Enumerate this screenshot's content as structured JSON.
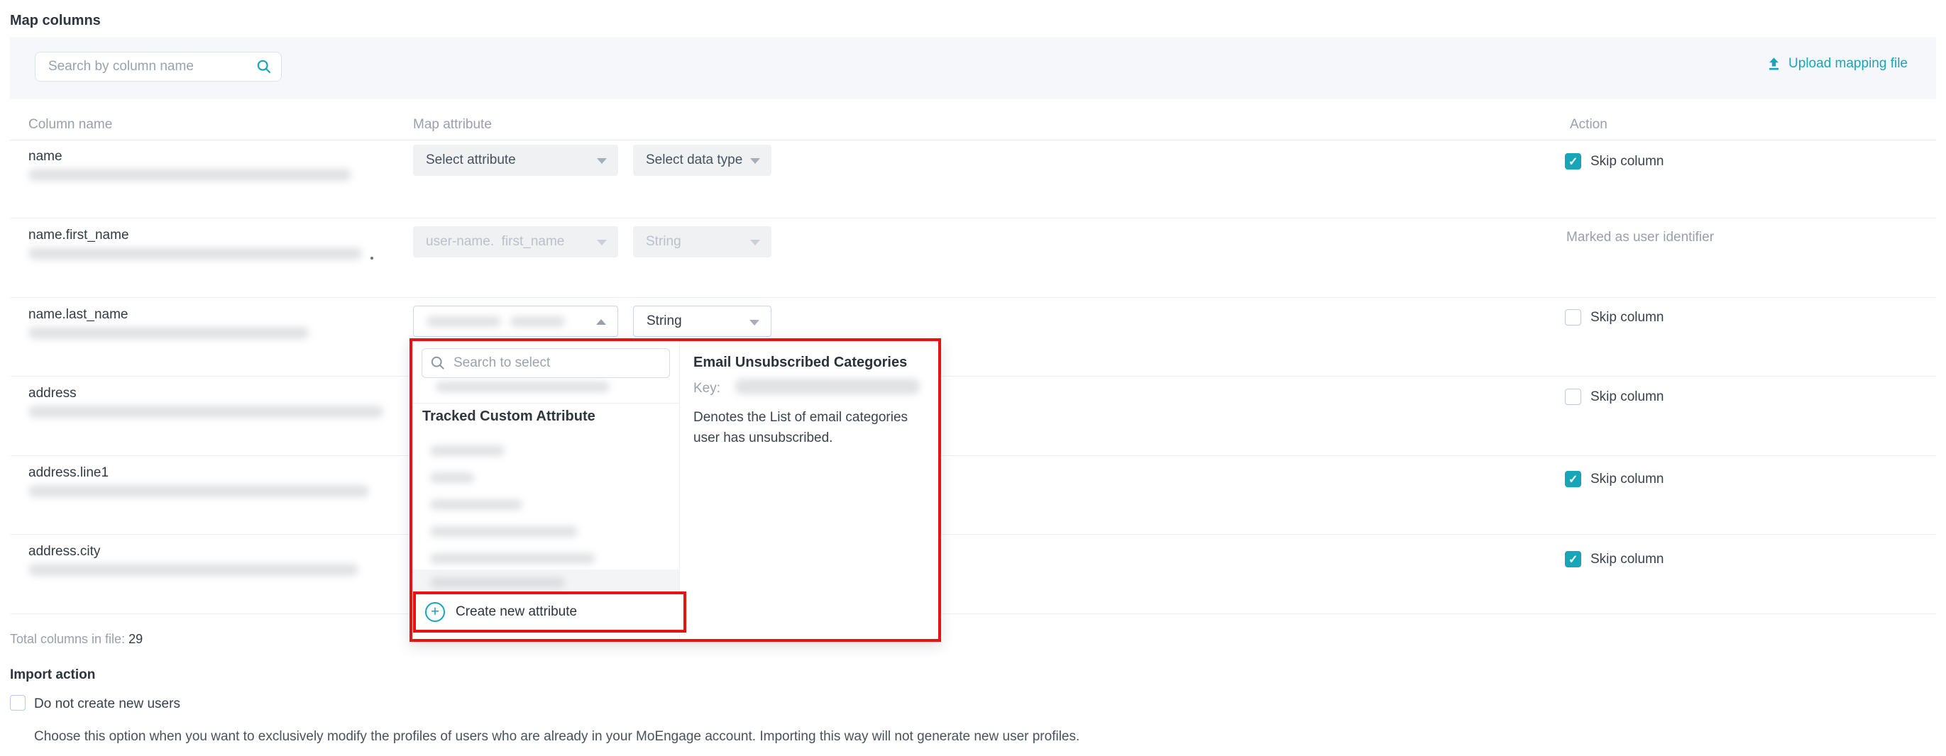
{
  "colors": {
    "accent_teal": "#17A6B8",
    "annotation_red": "#E41414"
  },
  "page_title": "Map columns",
  "toolbar": {
    "search_placeholder": "Search by column name",
    "upload_label": "Upload mapping file"
  },
  "table": {
    "headers": {
      "column": "Column name",
      "attribute": "Map attribute",
      "action": "Action"
    },
    "skip_label": "Skip column",
    "rows": [
      {
        "name": "name",
        "attr_value": "Select attribute",
        "type_value": "Select data type",
        "action": "skip",
        "skip_checked": true
      },
      {
        "name": "name.first_name",
        "attr_value": "user-name.  first_name",
        "type_value": "String",
        "action": "identifier",
        "action_text": "Marked as user identifier"
      },
      {
        "name": "name.last_name",
        "attr_value": "",
        "type_value": "String",
        "action": "skip",
        "skip_checked": false
      },
      {
        "name": "address",
        "action": "skip",
        "skip_checked": false
      },
      {
        "name": "address.line1",
        "action": "skip",
        "skip_checked": true
      },
      {
        "name": "address.city",
        "action": "skip",
        "skip_checked": true
      }
    ],
    "total_label": "Total columns in file:",
    "total_value": "29"
  },
  "attribute_dropdown": {
    "search_placeholder": "Search to select",
    "section_header": "Tracked Custom Attribute",
    "create_label": "Create new attribute",
    "detail_panel": {
      "title": "Email Unsubscribed Categories",
      "key_label": "Key:",
      "description": "Denotes the List of email categories user has unsubscribed."
    }
  },
  "import_action": {
    "heading": "Import action",
    "checkbox_label": "Do not create new users",
    "checkbox_checked": false,
    "description": "Choose this option when you want to exclusively modify the profiles of users who are already in your MoEngage account. Importing this way will not generate new user profiles."
  }
}
